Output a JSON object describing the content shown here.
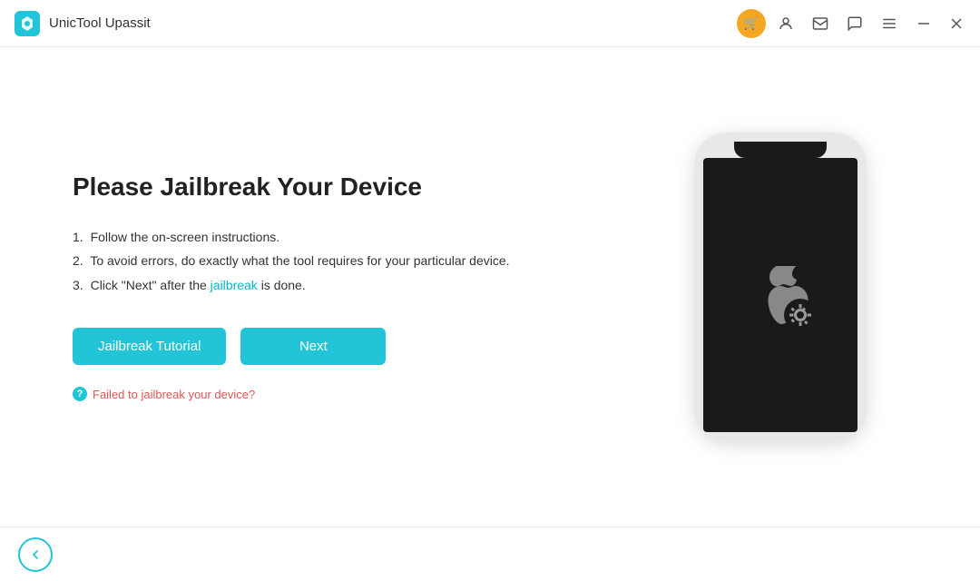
{
  "titleBar": {
    "appName": "UnicTool Upassit",
    "icons": {
      "cart": "🛒",
      "user": "👤",
      "mail": "✉",
      "chat": "💬",
      "menu": "☰",
      "minimize": "—",
      "close": "✕"
    }
  },
  "main": {
    "title": "Please Jailbreak Your Device",
    "instructions": [
      {
        "num": "1.",
        "text": "Follow the on-screen instructions."
      },
      {
        "num": "2.",
        "text": "To avoid errors, do exactly what the tool requires for your particular device."
      },
      {
        "num": "3.",
        "text": "Click \"Next\" after the ",
        "highlight": "jailbreak",
        "textAfter": " is done."
      }
    ],
    "buttons": {
      "tutorial": "Jailbreak Tutorial",
      "next": "Next"
    },
    "failedLink": "Failed to jailbreak your device?"
  },
  "bottomBar": {
    "backLabel": "←"
  }
}
